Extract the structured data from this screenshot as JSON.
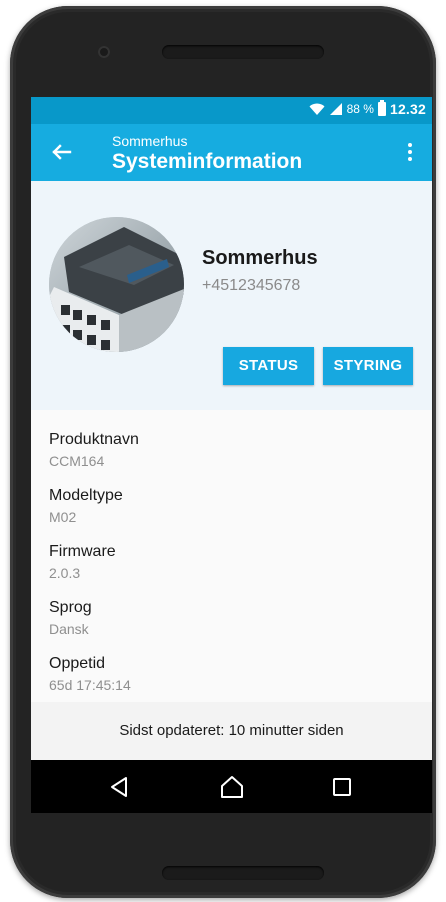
{
  "statusbar": {
    "battery_percent": "88 %",
    "time": "12.32"
  },
  "appbar": {
    "subtitle": "Sommerhus",
    "title": "Systeminformation"
  },
  "device": {
    "name": "Sommerhus",
    "phone": "+4512345678"
  },
  "buttons": {
    "status_label": "STATUS",
    "styring_label": "STYRING"
  },
  "info": [
    {
      "label": "Produktnavn",
      "value": "CCM164"
    },
    {
      "label": "Modeltype",
      "value": "M02"
    },
    {
      "label": "Firmware",
      "value": "2.0.3"
    },
    {
      "label": "Sprog",
      "value": "Dansk"
    },
    {
      "label": "Oppetid",
      "value": "65d 17:45:14"
    }
  ],
  "footer": {
    "updated_text": "Sidst opdateret: 10 minutter siden"
  },
  "colors": {
    "statusbar": "#0898c9",
    "appbar": "#16ace0",
    "button": "#17a8e0"
  }
}
